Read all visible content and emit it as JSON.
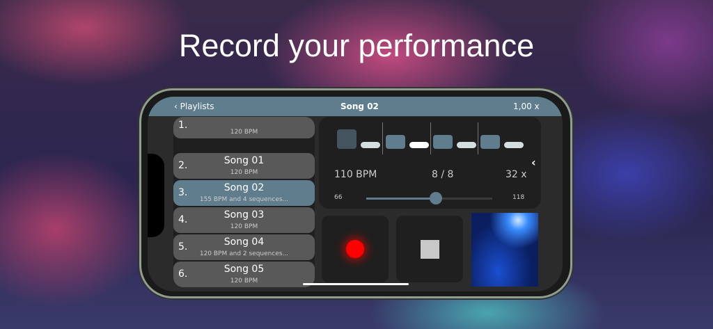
{
  "headline": "Record your performance",
  "header": {
    "back_label": "Playlists",
    "title": "Song 02",
    "speed": "1,00 x"
  },
  "transport": {
    "icons": [
      "skip-to-start-icon",
      "rewind-icon",
      "fast-forward-icon",
      "skip-to-end-icon"
    ]
  },
  "songs": [
    {
      "num": "1.",
      "title": "",
      "sub": "120 BPM"
    },
    {
      "num": "2.",
      "title": "Song 01",
      "sub": "120 BPM"
    },
    {
      "num": "3.",
      "title": "Song 02",
      "sub": "155 BPM and 4 sequences...",
      "selected": true
    },
    {
      "num": "4.",
      "title": "Song 03",
      "sub": "120 BPM"
    },
    {
      "num": "5.",
      "title": "Song 04",
      "sub": "120 BPM and 2 sequences..."
    },
    {
      "num": "6.",
      "title": "Song 05",
      "sub": "120 BPM"
    }
  ],
  "sequence": {
    "bpm": "110 BPM",
    "time_signature": "8 / 8",
    "repeat": "32 x",
    "slider_min": "66",
    "slider_max": "118",
    "slider_value_fraction": 0.55
  },
  "colors": {
    "accent": "#5f7d8c",
    "record": "#ff0000"
  }
}
